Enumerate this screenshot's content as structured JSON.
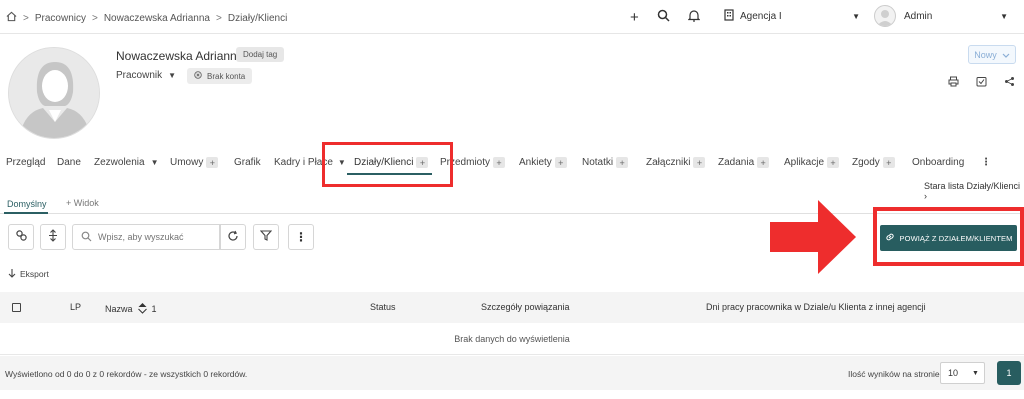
{
  "breadcrumb": {
    "items": [
      "Pracownicy",
      "Nowaczewska Adrianna",
      "Działy/Klienci"
    ],
    "sep": ">"
  },
  "topbar": {
    "agency": "Agencja I",
    "user": "Admin",
    "icons": [
      "plus-icon",
      "search-icon",
      "bell-icon",
      "building-icon"
    ]
  },
  "profile": {
    "name": "Nowaczewska Adrianna",
    "add_tag": "Dodaj tag",
    "role": "Pracownik",
    "no_account": "Brak konta",
    "status_button": "Nowy"
  },
  "tabs": [
    {
      "label": "Przegląd"
    },
    {
      "label": "Dane"
    },
    {
      "label": "Zezwolenia"
    },
    {
      "label": "Umowy"
    },
    {
      "label": "Grafik"
    },
    {
      "label": "Kadry i Płace"
    },
    {
      "label": "Działy/Klienci"
    },
    {
      "label": "Przedmioty"
    },
    {
      "label": "Ankiety"
    },
    {
      "label": "Notatki"
    },
    {
      "label": "Załączniki"
    },
    {
      "label": "Zadania"
    },
    {
      "label": "Aplikacje"
    },
    {
      "label": "Zgody"
    },
    {
      "label": "Onboarding"
    }
  ],
  "old_list_link": "Stara lista Działy/Klienci",
  "subtabs": {
    "default": "Domyślny",
    "add_view": "+ Widok"
  },
  "search": {
    "placeholder": "Wpisz, aby wyszukać"
  },
  "link_button": "POWIĄŻ Z DZIAŁEM/KLIENTEM",
  "export_label": "Eksport",
  "table": {
    "columns": {
      "lp": "LP",
      "name": "Nazwa",
      "name_sort": "1",
      "status": "Status",
      "details": "Szczegóły powiązania",
      "days": "Dni pracy pracownika w Dziale/u Klienta z innej agencji"
    },
    "empty": "Brak danych do wyświetlenia"
  },
  "footer": {
    "info": "Wyświetlono od 0 do 0 z 0 rekordów - ze wszystkich 0 rekordów.",
    "per_page_label": "Ilość wyników na stronie",
    "per_page": "10",
    "page": "1"
  },
  "colors": {
    "accent": "#285d60",
    "highlight": "#ee2d2d"
  }
}
